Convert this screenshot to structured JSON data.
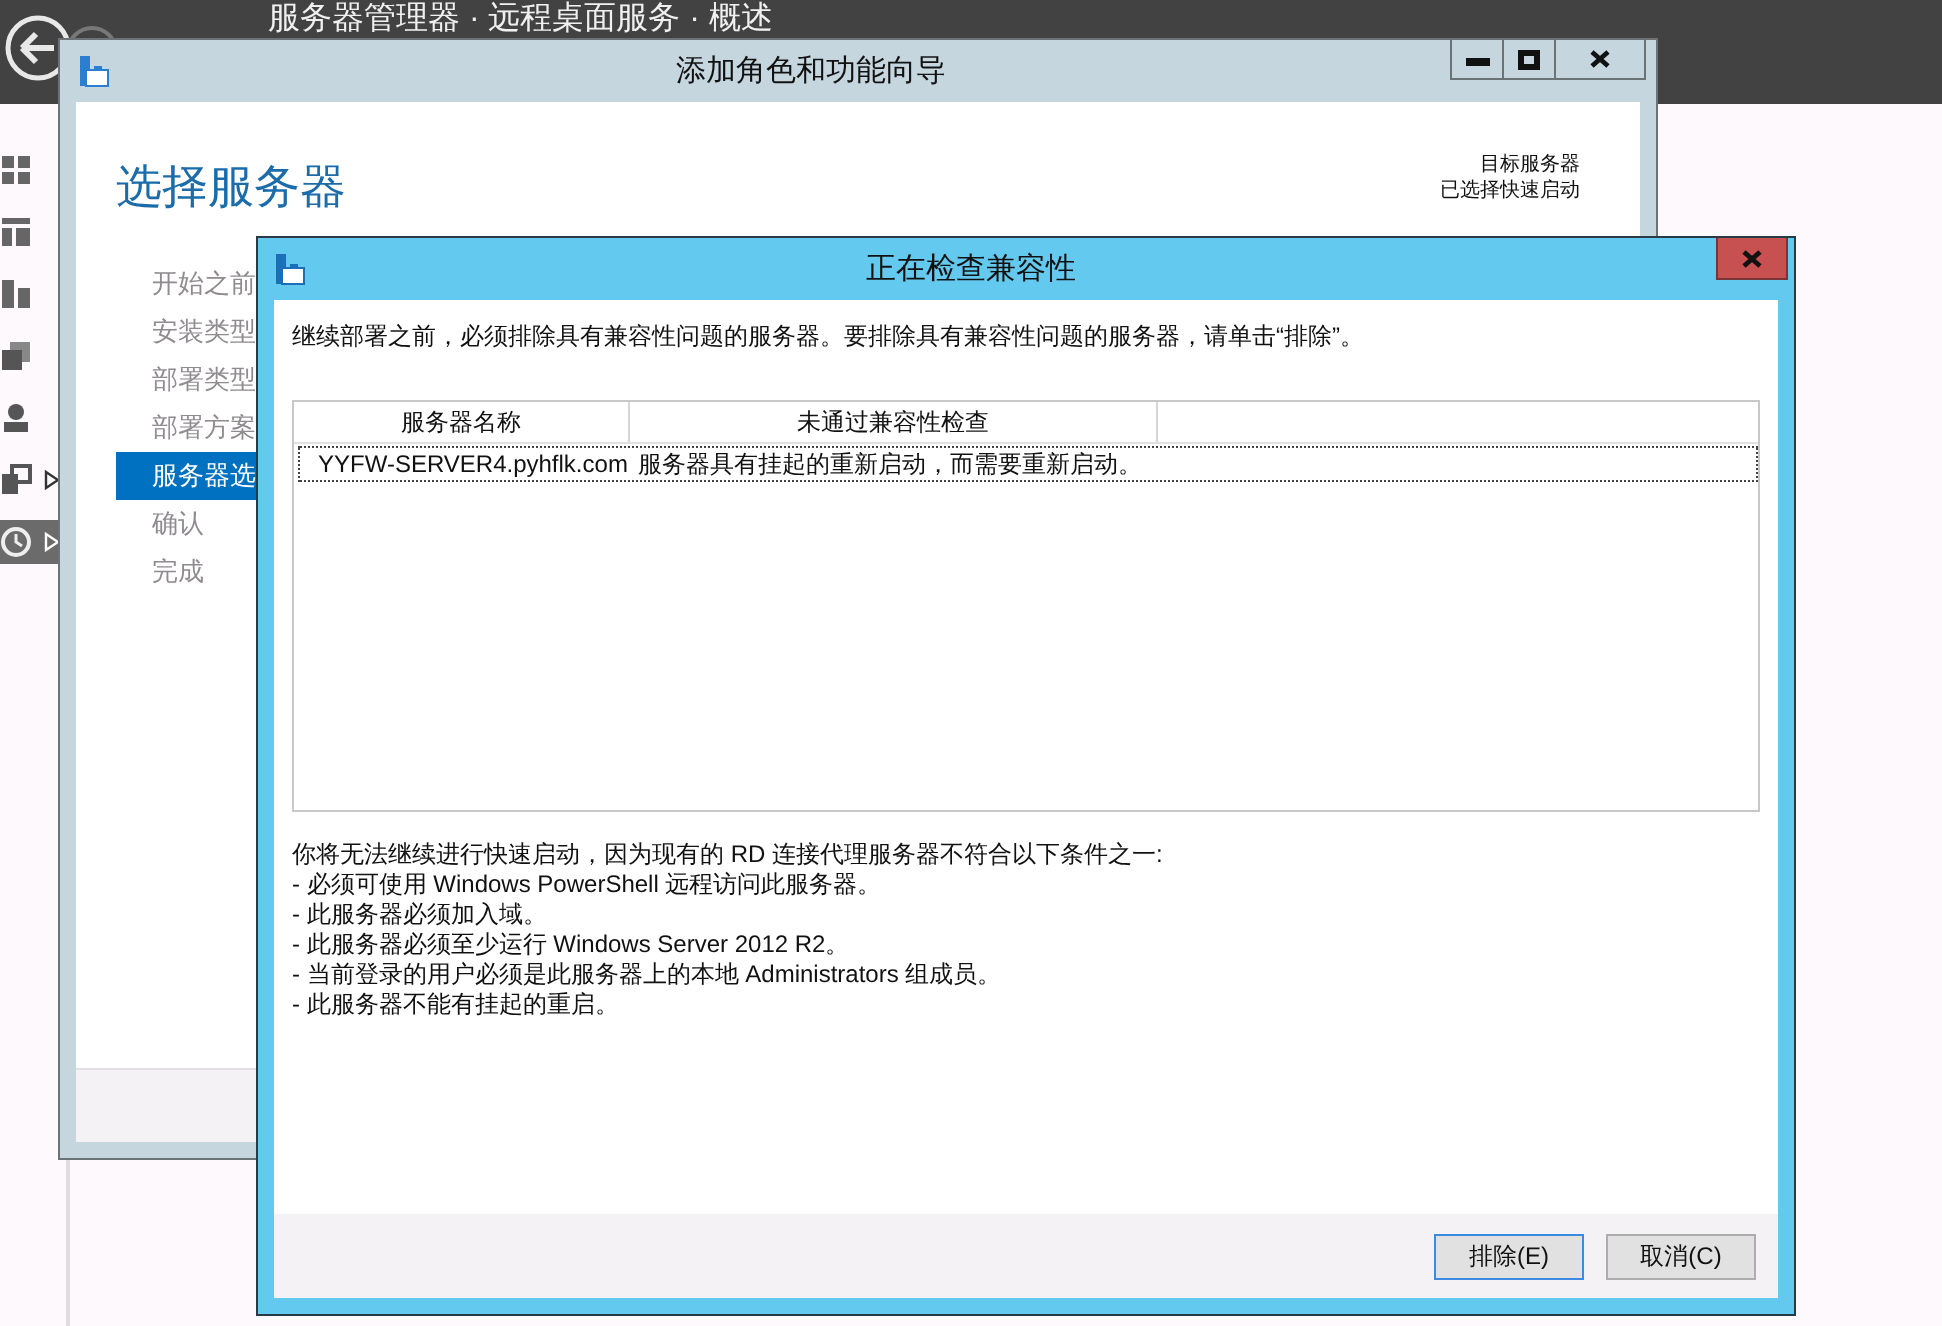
{
  "app": {
    "title": "服务器管理器 · 远程桌面服务 · 概述",
    "sidebar": [
      {
        "selected": false,
        "expandable": false
      },
      {
        "selected": false,
        "expandable": false
      },
      {
        "selected": false,
        "expandable": false
      },
      {
        "selected": false,
        "expandable": false
      },
      {
        "selected": false,
        "expandable": false
      },
      {
        "selected": false,
        "expandable": true
      },
      {
        "selected": true,
        "expandable": true
      }
    ]
  },
  "wizard": {
    "title": "添加角色和功能向导",
    "heading": "选择服务器",
    "target": [
      "目标服务器",
      "已选择快速启动"
    ],
    "steps": [
      {
        "label": "开始之前",
        "selected": false
      },
      {
        "label": "安装类型",
        "selected": false
      },
      {
        "label": "部署类型",
        "selected": false
      },
      {
        "label": "部署方案",
        "selected": false
      },
      {
        "label": "服务器选",
        "selected": true
      },
      {
        "label": "确认",
        "selected": false
      },
      {
        "label": "完成",
        "selected": false
      }
    ]
  },
  "dialog": {
    "title": "正在检查兼容性",
    "intro": "继续部署之前，必须排除具有兼容性问题的服务器。要排除具有兼容性问题的服务器，请单击“排除”。",
    "table": {
      "columns": [
        "服务器名称",
        "未通过兼容性检查"
      ],
      "rows": [
        {
          "cells": [
            "YYFW-SERVER4.pyhflk.com",
            "服务器具有挂起的重新启动，而需要重新启动。"
          ],
          "focused": true
        }
      ]
    },
    "message": [
      "你将无法继续进行快速启动，因为现有的 RD 连接代理服务器不符合以下条件之一:",
      "- 必须可使用 Windows PowerShell 远程访问此服务器。",
      "- 此服务器必须加入域。",
      "- 此服务器必须至少运行 Windows Server 2012 R2。",
      "- 当前登录的用户必须是此服务器上的本地 Administrators 组成员。",
      "- 此服务器不能有挂起的重启。"
    ],
    "buttons": [
      {
        "label": "排除(E)",
        "default": true
      },
      {
        "label": "取消(C)",
        "default": false
      }
    ]
  }
}
